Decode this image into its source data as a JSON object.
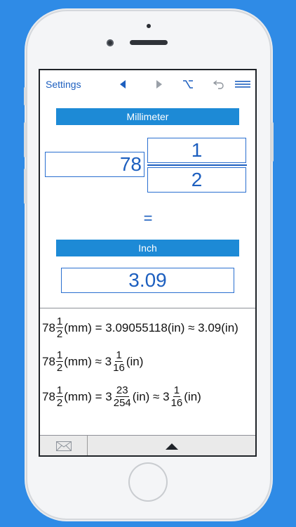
{
  "colors": {
    "background": "#2f8be6",
    "accent": "#1d8ad6",
    "text": "#1d5fbf"
  },
  "toolbar": {
    "settings_label": "Settings",
    "icons": [
      "triangle-left-icon",
      "triangle-right-icon",
      "option-key-icon",
      "undo-icon",
      "menu-icon"
    ]
  },
  "converter": {
    "from_unit": "Millimeter",
    "whole_value": "78",
    "numerator": "1",
    "denominator": "2",
    "equals_sign": "=",
    "to_unit": "Inch",
    "result": "3.09"
  },
  "results": {
    "line1": {
      "whole": "78",
      "num": "1",
      "den": "2",
      "mid": "(mm) = 3.09055118(in) ≈ 3.09(in)"
    },
    "line2": {
      "whole": "78",
      "num": "1",
      "den": "2",
      "mid": "(mm) ≈ 3",
      "num2": "1",
      "den2": "16",
      "end": "(in)"
    },
    "line3": {
      "whole": "78",
      "num": "1",
      "den": "2",
      "mid": "(mm) = 3",
      "num2": "23",
      "den2": "254",
      "mid2": "(in) ≈ 3",
      "num3": "1",
      "den3": "16",
      "end": "(in)"
    }
  },
  "bottom_bar": {
    "icons": [
      "mail-icon",
      "up-arrow-icon"
    ]
  }
}
